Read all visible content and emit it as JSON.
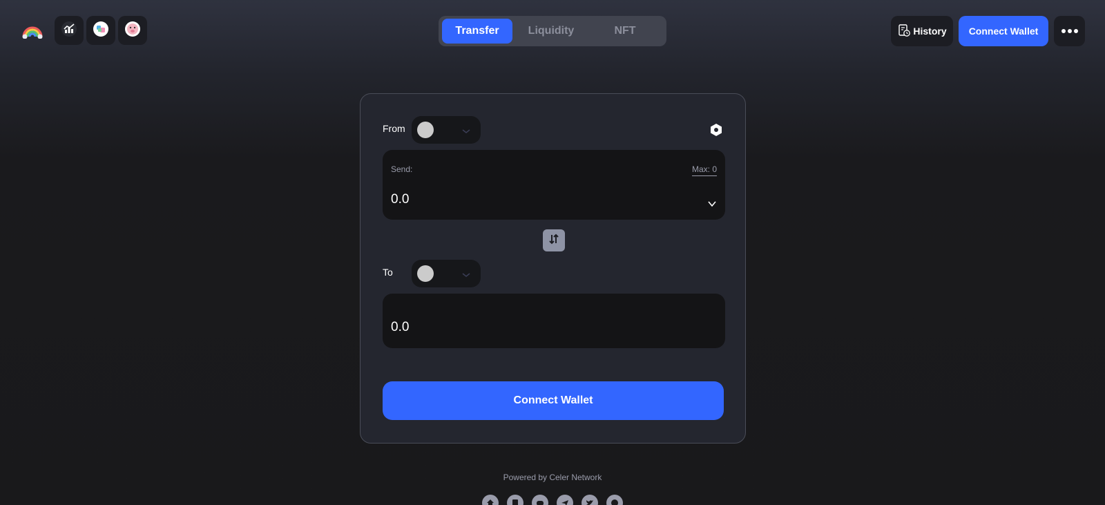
{
  "header": {
    "logo_icon": "rainbow-logo-icon",
    "quick_icons": [
      "analytics-icon",
      "token-app-icon",
      "pig-mascot-icon"
    ],
    "tabs": [
      {
        "label": "Transfer",
        "active": true
      },
      {
        "label": "Liquidity",
        "active": false
      },
      {
        "label": "NFT",
        "active": false
      }
    ],
    "history_label": "History",
    "connect_label": "Connect Wallet",
    "more_icon": "more-dots-icon"
  },
  "transfer": {
    "from_label": "From",
    "send_label": "Send:",
    "max_label": "Max: 0",
    "send_amount": "0.0",
    "to_label": "To",
    "receive_amount": "0.0",
    "connect_label": "Connect Wallet",
    "settings_icon": "settings-hex-icon",
    "swap_icon": "swap-arrows-icon"
  },
  "footer": {
    "powered_by": "Powered by Celer Network",
    "social_icons": [
      "home-icon",
      "docs-icon",
      "discord-icon",
      "telegram-icon",
      "twitter-icon",
      "github-icon"
    ]
  },
  "colors": {
    "accent": "#3366ff",
    "card_bg": "#24262f",
    "field_bg": "#141416",
    "muted_text": "#9a9cab"
  }
}
